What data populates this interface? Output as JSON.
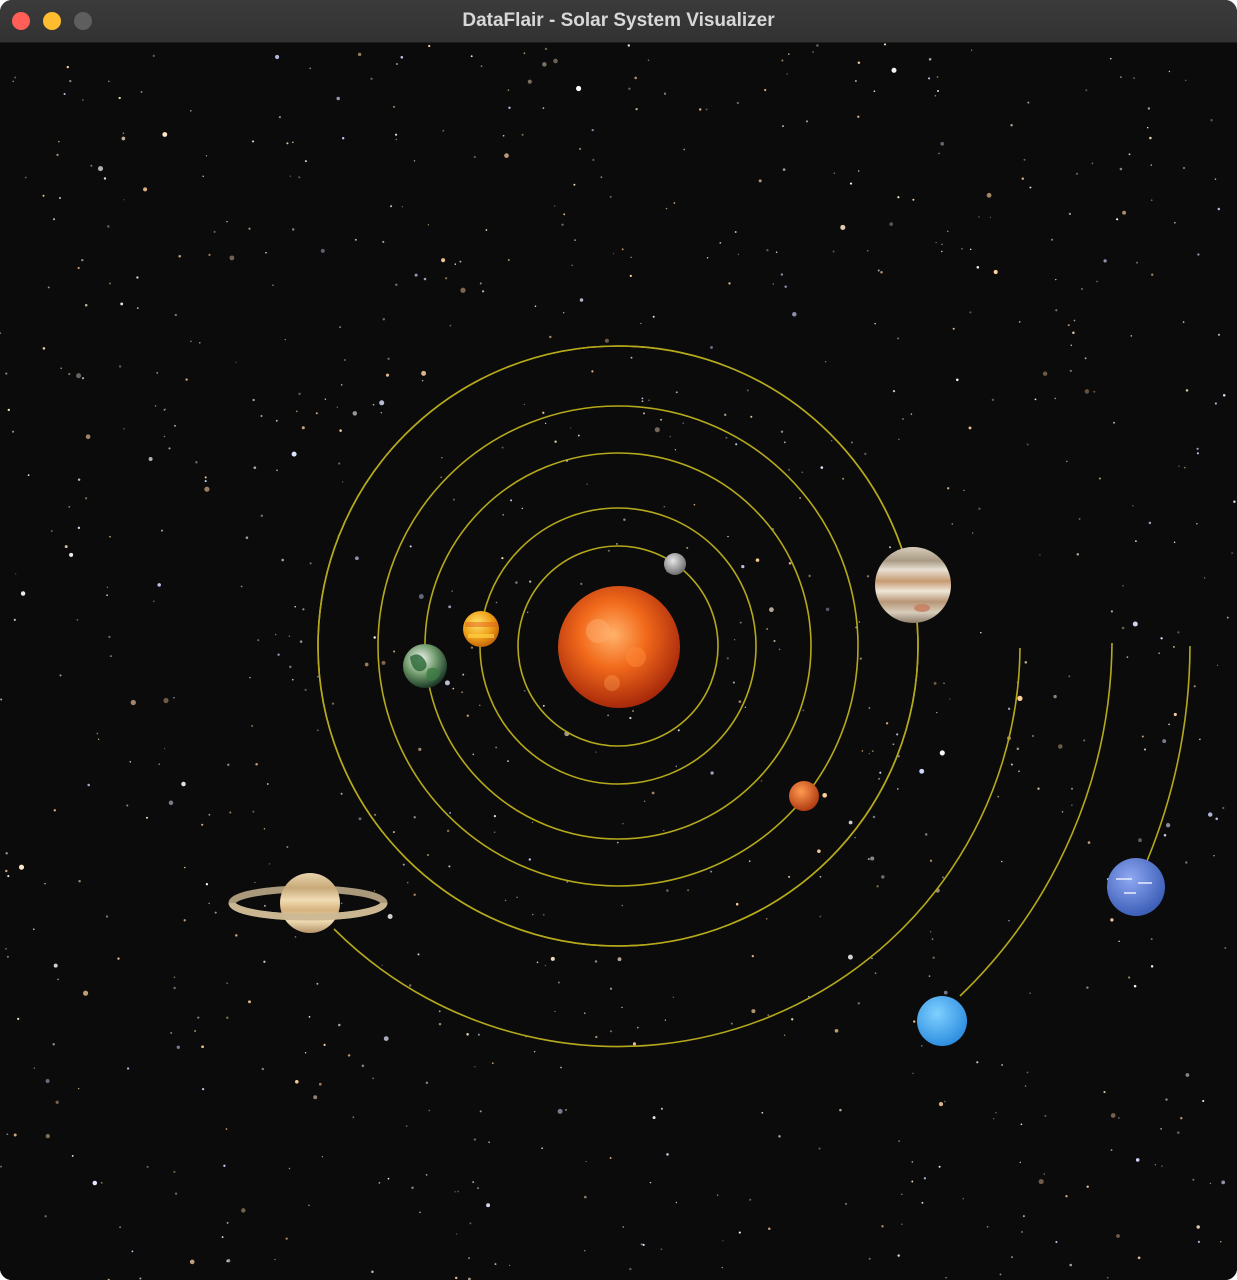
{
  "window": {
    "title": "DataFlair - Solar System Visualizer",
    "controls": {
      "close_color": "#ff5f57",
      "minimize_color": "#febc2e",
      "maximize_color": "#5e5e5e"
    }
  },
  "scene": {
    "background_color": "#0b0b0b",
    "orbit_color": "#b5a91b",
    "bodies": [
      {
        "id": "sun",
        "name": "Sun",
        "color": "#f05a12",
        "icon": "sun-icon"
      },
      {
        "id": "mercury",
        "name": "Mercury",
        "color": "#a9a9a9",
        "icon": "mercury-icon"
      },
      {
        "id": "venus",
        "name": "Venus",
        "color": "#f2b01e",
        "icon": "venus-icon"
      },
      {
        "id": "earth",
        "name": "Earth",
        "color": "#3f7a3c",
        "icon": "earth-icon"
      },
      {
        "id": "mars",
        "name": "Mars",
        "color": "#d9561f",
        "icon": "mars-icon"
      },
      {
        "id": "jupiter",
        "name": "Jupiter",
        "color": "#c9b89a",
        "icon": "jupiter-icon"
      },
      {
        "id": "saturn",
        "name": "Saturn",
        "color": "#d9c08f",
        "icon": "saturn-icon"
      },
      {
        "id": "uranus",
        "name": "Uranus",
        "color": "#52b7ff",
        "icon": "uranus-icon"
      },
      {
        "id": "neptune",
        "name": "Neptune",
        "color": "#5f82dc",
        "icon": "neptune-icon"
      }
    ]
  }
}
